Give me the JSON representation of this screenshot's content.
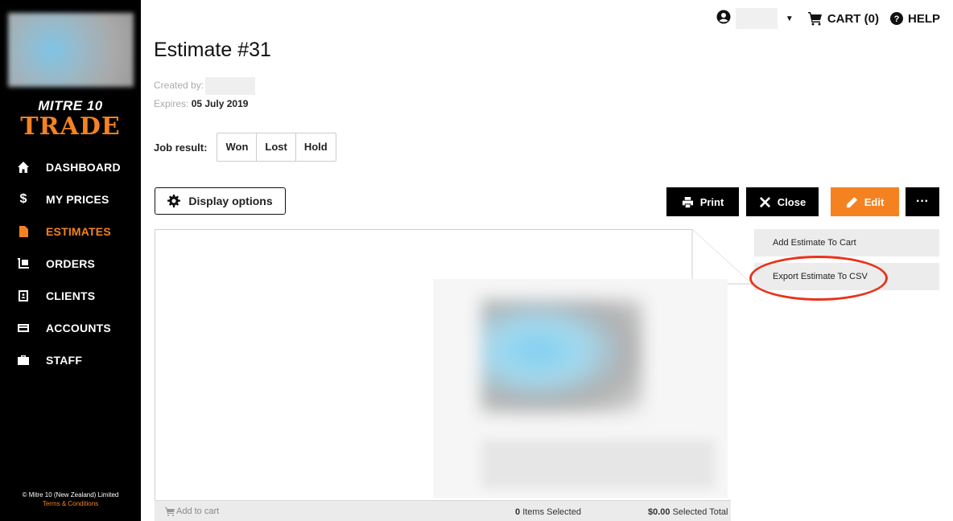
{
  "sidebar": {
    "brand_top": "MITRE 10",
    "brand_main": "TRADE",
    "items": [
      {
        "label": "DASHBOARD"
      },
      {
        "label": "MY PRICES"
      },
      {
        "label": "ESTIMATES"
      },
      {
        "label": "ORDERS"
      },
      {
        "label": "CLIENTS"
      },
      {
        "label": "ACCOUNTS"
      },
      {
        "label": "STAFF"
      }
    ],
    "active_item": "ESTIMATES",
    "footer_copyright": "© Mitre 10 (New Zealand) Limited",
    "footer_terms": "Terms & Conditions"
  },
  "header": {
    "cart_label": "CART (0)",
    "help_label": "HELP"
  },
  "estimate": {
    "title": "Estimate #31",
    "created_label": "Created by:",
    "expires_label": "Expires:",
    "expires_value": "05 July 2019"
  },
  "job_result": {
    "label": "Job result:",
    "options": [
      "Won",
      "Lost",
      "Hold"
    ]
  },
  "toolbar": {
    "display_options": "Display options",
    "print": "Print",
    "close": "Close",
    "edit": "Edit",
    "more": "···"
  },
  "menu": {
    "items": [
      "Add Estimate To Cart",
      "Export Estimate To CSV"
    ]
  },
  "doc_footer": {
    "add_to_cart": "Add to cart",
    "items_count": "0",
    "items_label": "Items Selected",
    "total_value": "$0.00",
    "total_label": "Selected Total"
  },
  "colors": {
    "brand_orange": "#f58220",
    "sidebar_bg": "#000000",
    "highlight_circle": "#e8341c"
  }
}
